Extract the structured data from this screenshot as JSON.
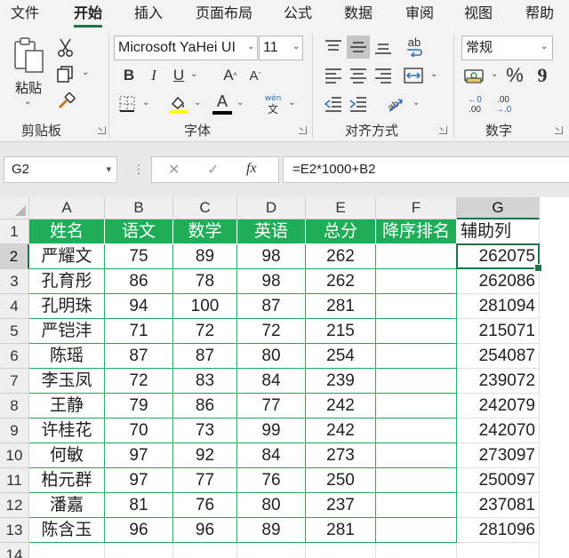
{
  "tabs": [
    {
      "label": "文件",
      "active": false
    },
    {
      "label": "开始",
      "active": true
    },
    {
      "label": "插入",
      "active": false
    },
    {
      "label": "页面布局",
      "active": false
    },
    {
      "label": "公式",
      "active": false
    },
    {
      "label": "数据",
      "active": false
    },
    {
      "label": "审阅",
      "active": false
    },
    {
      "label": "视图",
      "active": false
    },
    {
      "label": "帮助",
      "active": false
    }
  ],
  "ribbon": {
    "clipboard": {
      "group_label": "剪贴板",
      "paste_label": "粘贴"
    },
    "font": {
      "group_label": "字体",
      "font_name": "Microsoft YaHei UI",
      "font_size": "11",
      "bold": "B",
      "italic": "I",
      "underline": "U",
      "grow": "A",
      "shrink": "A",
      "font_color_glyph": "A",
      "phonetic_top": "wén",
      "phonetic_bottom": "文"
    },
    "alignment": {
      "group_label": "对齐方式",
      "wrap_glyph": "ab"
    },
    "number": {
      "group_label": "数字",
      "format": "常规",
      "percent": "%",
      "comma": "9",
      "inc_decimal_top": "←0",
      "inc_decimal_bottom": ".00",
      "dec_decimal_top": ".00",
      "dec_decimal_bottom": "→.0"
    },
    "colors": {
      "highlight": "#ffff00",
      "font_color": "#000000",
      "accent": "#217346"
    }
  },
  "formula_bar": {
    "name_box": "G2",
    "dots": "⋮",
    "cancel": "✕",
    "enter": "✓",
    "fx": "fx",
    "formula": "=E2*1000+B2"
  },
  "sheet": {
    "columns": [
      "A",
      "B",
      "C",
      "D",
      "E",
      "F",
      "G"
    ],
    "selected_column": "G",
    "selected_row": "2",
    "row_numbers": [
      "1",
      "2",
      "3",
      "4",
      "5",
      "6",
      "7",
      "8",
      "9",
      "10",
      "11",
      "12",
      "13",
      "14"
    ],
    "header": [
      "姓名",
      "语文",
      "数学",
      "英语",
      "总分",
      "降序排名",
      "辅助列"
    ],
    "rows": [
      [
        "严耀文",
        "75",
        "89",
        "98",
        "262",
        "",
        "262075"
      ],
      [
        "孔育彤",
        "86",
        "78",
        "98",
        "262",
        "",
        "262086"
      ],
      [
        "孔明珠",
        "94",
        "100",
        "87",
        "281",
        "",
        "281094"
      ],
      [
        "严铠沣",
        "71",
        "72",
        "72",
        "215",
        "",
        "215071"
      ],
      [
        "陈瑶",
        "87",
        "87",
        "80",
        "254",
        "",
        "254087"
      ],
      [
        "李玉凤",
        "72",
        "83",
        "84",
        "239",
        "",
        "239072"
      ],
      [
        "王静",
        "79",
        "86",
        "77",
        "242",
        "",
        "242079"
      ],
      [
        "许桂花",
        "70",
        "73",
        "99",
        "242",
        "",
        "242070"
      ],
      [
        "何敏",
        "97",
        "92",
        "84",
        "273",
        "",
        "273097"
      ],
      [
        "柏元群",
        "97",
        "77",
        "76",
        "250",
        "",
        "250097"
      ],
      [
        "潘嘉",
        "81",
        "76",
        "80",
        "237",
        "",
        "237081"
      ],
      [
        "陈含玉",
        "96",
        "96",
        "89",
        "281",
        "",
        "281096"
      ]
    ]
  }
}
